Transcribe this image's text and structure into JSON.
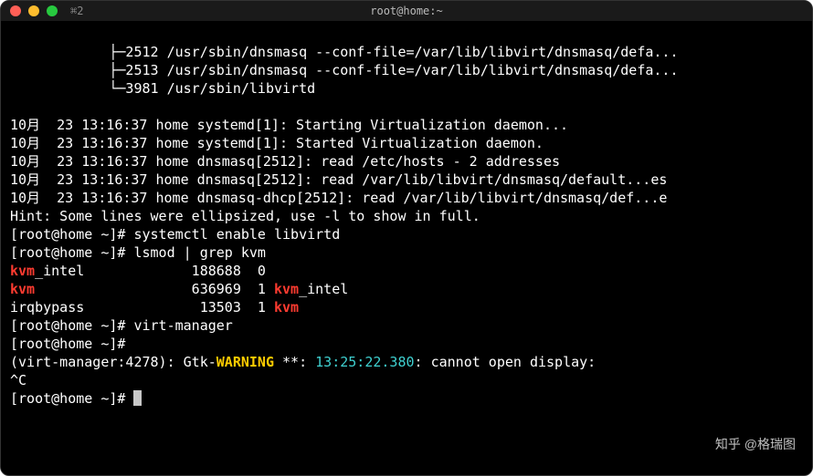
{
  "window": {
    "tab_label": "⌘2",
    "title": "root@home:~"
  },
  "tree": {
    "l1": "            ├─2512 /usr/sbin/dnsmasq --conf-file=/var/lib/libvirt/dnsmasq/defa...",
    "l2": "            ├─2513 /usr/sbin/dnsmasq --conf-file=/var/lib/libvirt/dnsmasq/defa...",
    "l3": "            └─3981 /usr/sbin/libvirtd"
  },
  "log": {
    "l1": "10月  23 13:16:37 home systemd[1]: Starting Virtualization daemon...",
    "l2": "10月  23 13:16:37 home systemd[1]: Started Virtualization daemon.",
    "l3": "10月  23 13:16:37 home dnsmasq[2512]: read /etc/hosts - 2 addresses",
    "l4": "10月  23 13:16:37 home dnsmasq[2512]: read /var/lib/libvirt/dnsmasq/default...es",
    "l5": "10月  23 13:16:37 home dnsmasq-dhcp[2512]: read /var/lib/libvirt/dnsmasq/def...e",
    "hint": "Hint: Some lines were ellipsized, use -l to show in full."
  },
  "prompt": {
    "p1": "[root@home ~]# ",
    "cmd1": "systemctl enable libvirtd",
    "p2": "[root@home ~]# ",
    "cmd2": "lsmod | grep kvm",
    "p3": "[root@home ~]# ",
    "cmd3": "virt-manager",
    "p4": "[root@home ~]# ",
    "p5": "[root@home ~]# "
  },
  "kvm": {
    "r1a": "kvm",
    "r1b": "_intel             188688  0 ",
    "r2a": "kvm",
    "r2b": "                   636969  1 ",
    "r2c": "kvm",
    "r2d": "_intel",
    "r3a": "irqbypass              13503  1 ",
    "r3b": "kvm"
  },
  "gtk": {
    "prefix": "(virt-manager:4278): Gtk-",
    "warn": "WARNING",
    "mid": " **: ",
    "time": "13:25:22.380",
    "suffix": ": cannot open display: "
  },
  "ctrlc": "^C",
  "watermark": "知乎 @格瑞图"
}
